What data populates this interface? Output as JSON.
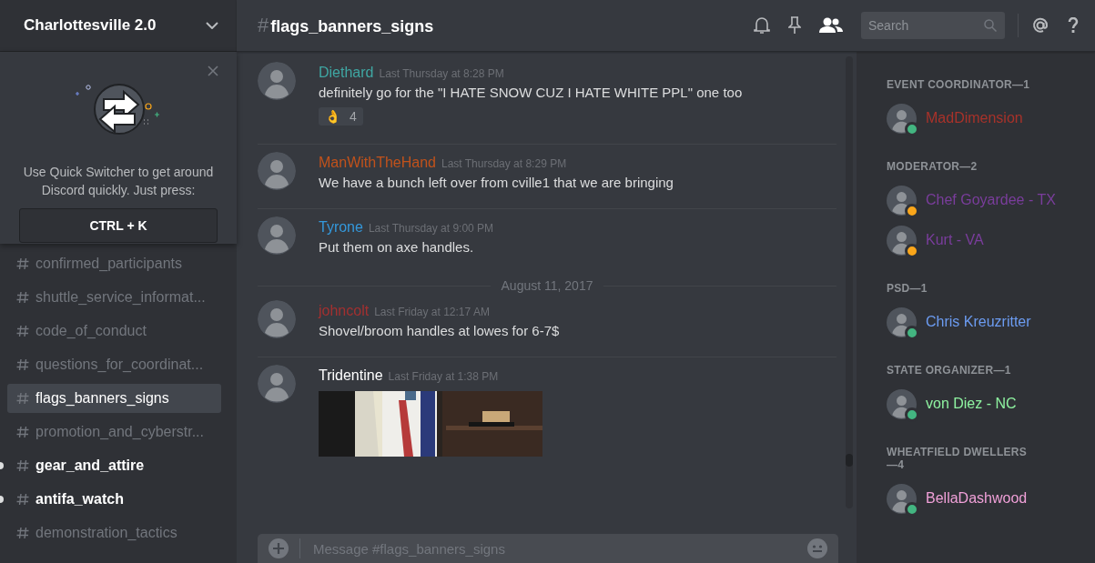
{
  "server": {
    "name": "Charlottesville 2.0"
  },
  "quick_switcher": {
    "text": "Use Quick Switcher to get around Discord quickly. Just press:",
    "shortcut": "CTRL + K"
  },
  "channels": [
    {
      "name": "confirmed_participants",
      "selected": false,
      "unread": false
    },
    {
      "name": "shuttle_service_informat...",
      "selected": false,
      "unread": false
    },
    {
      "name": "code_of_conduct",
      "selected": false,
      "unread": false
    },
    {
      "name": "questions_for_coordinat...",
      "selected": false,
      "unread": false
    },
    {
      "name": "flags_banners_signs",
      "selected": true,
      "unread": false
    },
    {
      "name": "promotion_and_cyberstr...",
      "selected": false,
      "unread": false
    },
    {
      "name": "gear_and_attire",
      "selected": false,
      "unread": true
    },
    {
      "name": "antifa_watch",
      "selected": false,
      "unread": true
    },
    {
      "name": "demonstration_tactics",
      "selected": false,
      "unread": false
    }
  ],
  "header": {
    "hash": "#",
    "channel": "flags_banners_signs",
    "search_placeholder": "Search"
  },
  "messages": [
    {
      "kind": "message",
      "author": "Diethard",
      "color": "#3fa7a3",
      "time": "Last Thursday at 8:28 PM",
      "text": "definitely go for the \"I HATE SNOW CUZ I HATE WHITE PPL\" one too",
      "reaction": {
        "emoji": "👌",
        "count": "4"
      }
    },
    {
      "kind": "message",
      "author": "ManWithTheHand",
      "color": "#c1521b",
      "time": "Last Thursday at 8:29 PM",
      "text": "We have a bunch left over from cville1 that we are bringing"
    },
    {
      "kind": "message",
      "author": "Tyrone",
      "color": "#3498db",
      "time": "Last Thursday at 9:00 PM",
      "text": "Put them on axe handles."
    },
    {
      "kind": "divider",
      "text": "August 11, 2017"
    },
    {
      "kind": "message",
      "author": "johncolt",
      "color": "#a33030",
      "time": "Last Friday at 12:17 AM",
      "text": "Shovel/broom handles at lowes for 6-7$"
    },
    {
      "kind": "message",
      "author": "Tridentine",
      "color": "#ffffff",
      "time": "Last Friday at 1:38 PM"
    }
  ],
  "composer": {
    "placeholder": "Message #flags_banners_signs"
  },
  "member_groups": [
    {
      "title": "EVENT COORDINATOR—1",
      "members": [
        {
          "name": "MadDimension",
          "color": "#a8322a",
          "idle": false
        }
      ]
    },
    {
      "title": "MODERATOR—2",
      "members": [
        {
          "name": "Chef Goyardee - TX",
          "color": "#7a3d9c",
          "idle": true
        },
        {
          "name": "Kurt - VA",
          "color": "#7a3d9c",
          "idle": true
        }
      ]
    },
    {
      "title": "PSD—1",
      "members": [
        {
          "name": "Chris Kreuzritter",
          "color": "#6c9cf2",
          "idle": false
        }
      ]
    },
    {
      "title": "STATE ORGANIZER—1",
      "members": [
        {
          "name": "von Diez - NC",
          "color": "#8ef2a0",
          "idle": false
        }
      ]
    },
    {
      "title": "WHEATFIELD DWELLERS—4",
      "members": [
        {
          "name": "BellaDashwood",
          "color": "#f0a0d8",
          "idle": false
        }
      ]
    }
  ]
}
